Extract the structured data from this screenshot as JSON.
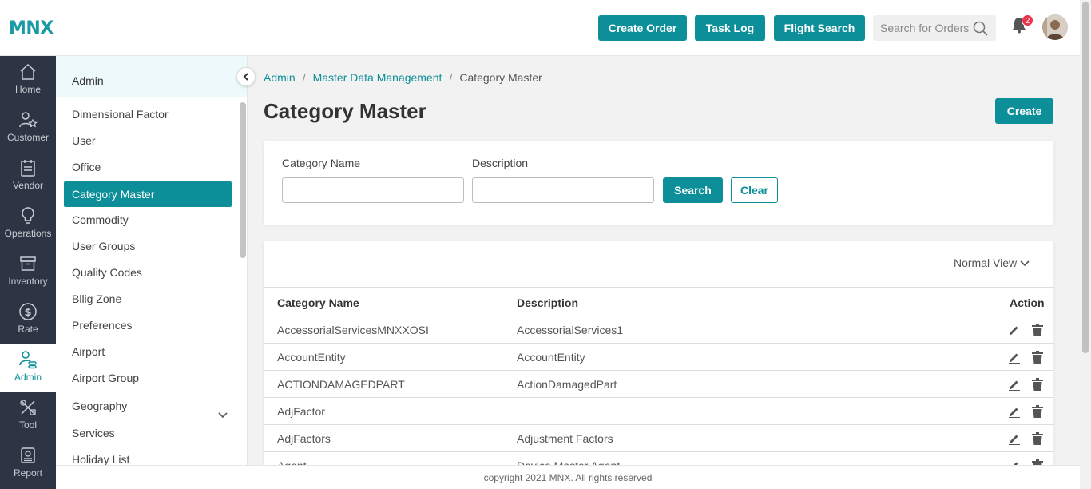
{
  "header": {
    "logo": "MNX",
    "buttons": [
      "Create Order",
      "Task Log",
      "Flight Search"
    ],
    "search_placeholder": "Search for Orders",
    "notification_count": "2"
  },
  "rail": {
    "items": [
      {
        "label": "Home",
        "icon": "home-icon"
      },
      {
        "label": "Customer",
        "icon": "customer-icon"
      },
      {
        "label": "Vendor",
        "icon": "vendor-icon"
      },
      {
        "label": "Operations",
        "icon": "operations-icon"
      },
      {
        "label": "Inventory",
        "icon": "inventory-icon"
      },
      {
        "label": "Rate",
        "icon": "rate-icon"
      },
      {
        "label": "Admin",
        "icon": "admin-icon",
        "active": true
      },
      {
        "label": "Tool",
        "icon": "tool-icon"
      },
      {
        "label": "Report",
        "icon": "report-icon"
      }
    ]
  },
  "submenu": {
    "title": "Admin",
    "items": [
      "Dimensional Factor",
      "User",
      "Office",
      "Category Master",
      "Commodity",
      "User Groups",
      "Quality Codes",
      "Bllig Zone",
      "Preferences",
      "Airport",
      "Airport Group",
      "Geography",
      "Services",
      "Holiday List"
    ],
    "active": "Category Master"
  },
  "breadcrumb": {
    "items": [
      "Admin",
      "Master Data Management"
    ],
    "current": "Category Master"
  },
  "page": {
    "title": "Category Master",
    "create_label": "Create"
  },
  "filters": {
    "category_name_label": "Category Name",
    "category_name_value": "",
    "description_label": "Description",
    "description_value": "",
    "search_label": "Search",
    "clear_label": "Clear"
  },
  "table": {
    "view_label": "Normal View",
    "columns": [
      "Category Name",
      "Description",
      "Action"
    ],
    "rows": [
      {
        "name": "AccessorialServicesMNXXOSI",
        "description": "AccessorialServices1"
      },
      {
        "name": "AccountEntity",
        "description": "AccountEntity"
      },
      {
        "name": "ACTIONDAMAGEDPART",
        "description": "ActionDamagedPart"
      },
      {
        "name": "AdjFactor",
        "description": ""
      },
      {
        "name": "AdjFactors",
        "description": "Adjustment Factors"
      },
      {
        "name": "Agent",
        "description": "Device Master Agent"
      }
    ]
  },
  "footer": {
    "text": "copyright 2021 MNX. All rights reserved"
  },
  "colors": {
    "accent": "#0c8f99",
    "rail": "#2d3545",
    "badge": "#e8334a"
  }
}
